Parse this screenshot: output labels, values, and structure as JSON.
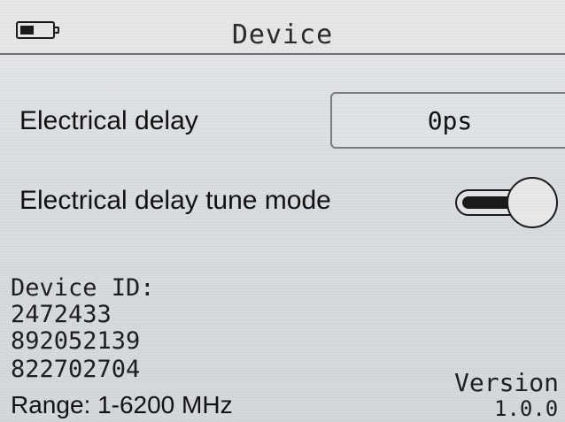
{
  "header": {
    "title": "Device",
    "battery_icon": "battery-icon"
  },
  "settings": {
    "electrical_delay": {
      "label": "Electrical delay",
      "value": "0ps"
    },
    "tune_mode": {
      "label": "Electrical delay tune mode",
      "state": "on"
    }
  },
  "device_info": {
    "id_label": "Device ID:",
    "id_lines": [
      "2472433",
      "892052139",
      "822702704"
    ],
    "range": "Range: 1-6200 MHz",
    "version_label": "Version",
    "version_value": "1.0.0"
  },
  "colors": {
    "background": "#dcdfe3",
    "text": "#111111",
    "accent": "#1a1a1a"
  }
}
